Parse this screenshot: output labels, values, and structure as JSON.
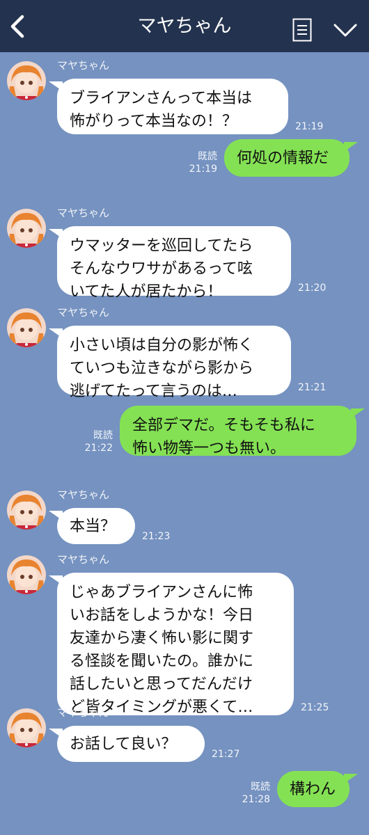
{
  "header": {
    "title": "マヤちゃん",
    "back_icon": "chevron-left-icon",
    "memo_icon": "notes-icon",
    "menu_icon": "chevron-down-icon",
    "bg": "#23324e"
  },
  "colors": {
    "chat_bg": "#7592c0",
    "incoming": "#ffffff",
    "outgoing": "#84e154"
  },
  "messages": [
    {
      "dir": "in",
      "sender": "マヤちゃん",
      "lines": [
        "ブライアンさんって本当は",
        "怖がりって本当なの！？"
      ],
      "time": "21:19"
    },
    {
      "dir": "out",
      "read": "既読",
      "lines": [
        "何処の情報だ"
      ],
      "time": "21:19"
    },
    {
      "dir": "in",
      "sender": "マヤちゃん",
      "lines": [
        "ウマッターを巡回してたら",
        "そんなウワサがあるって呟",
        "いてた人が居たから！"
      ],
      "time": "21:20"
    },
    {
      "dir": "in",
      "sender": "マヤちゃん",
      "lines": [
        "小さい頃は自分の影が怖く",
        "ていつも泣きながら影から",
        "逃げてたって言うのは…"
      ],
      "time": "21:21"
    },
    {
      "dir": "out",
      "read": "既読",
      "lines": [
        "全部デマだ。そもそも私に",
        "怖い物等一つも無い。"
      ],
      "time": "21:22"
    },
    {
      "dir": "in",
      "sender": "マヤちゃん",
      "lines": [
        "本当？"
      ],
      "time": "21:23"
    },
    {
      "dir": "in",
      "sender": "マヤちゃん",
      "lines": [
        "じゃあブライアンさんに怖",
        "いお話をしようかな！今日",
        "友達から凄く怖い影に関す",
        "る怪談を聞いたの。誰かに",
        "話したいと思ってだんだけ",
        "ど皆タイミングが悪くて…"
      ],
      "time": "21:25"
    },
    {
      "dir": "in",
      "sender": "マヤちゃん",
      "lines": [
        "お話して良い？"
      ],
      "time": "21:27"
    },
    {
      "dir": "out",
      "read": "既読",
      "lines": [
        "構わん"
      ],
      "time": "21:28"
    }
  ]
}
